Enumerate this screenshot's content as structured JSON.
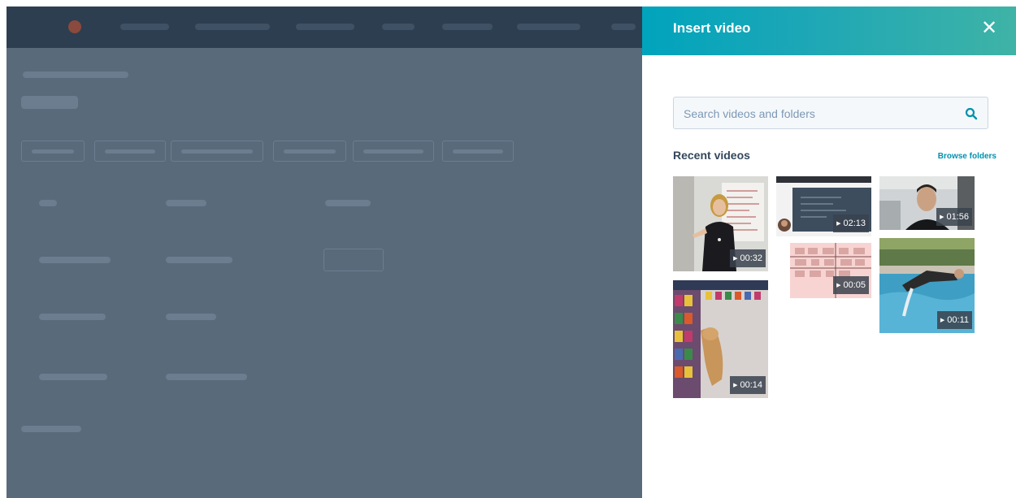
{
  "panel": {
    "title": "Insert video",
    "close_icon": "close-icon",
    "header_colors": [
      "#00a4bd",
      "#3fb3a6"
    ]
  },
  "search": {
    "placeholder": "Search videos and folders",
    "value": "",
    "icon": "search-icon"
  },
  "recent": {
    "title": "Recent videos",
    "browse_label": "Browse folders",
    "videos": [
      {
        "duration": "00:32"
      },
      {
        "duration": "02:13"
      },
      {
        "duration": "01:56"
      },
      {
        "duration": "00:05"
      },
      {
        "duration": "00:11"
      },
      {
        "duration": "00:14"
      }
    ]
  },
  "colors": {
    "accent": "#00a4bd",
    "link": "#0091ae",
    "overlay": "#596b7b"
  }
}
